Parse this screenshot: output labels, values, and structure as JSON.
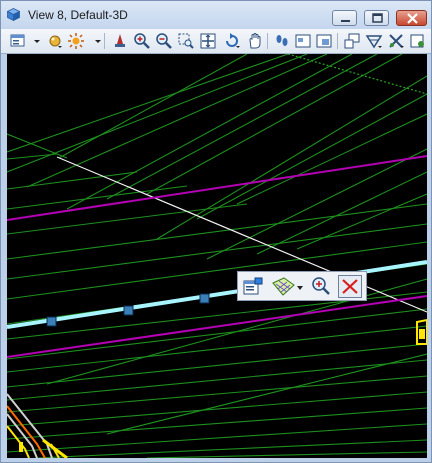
{
  "window": {
    "title": "View 8, Default-3D",
    "controls": [
      "minimize-icon",
      "maximize-icon",
      "close-icon"
    ]
  },
  "toolbar": {
    "icons": [
      "view-attributes-icon",
      "dropdown-arrow-icon",
      "display-style-icon",
      "lighting-icon",
      "update-view-icon",
      "zoom-in-icon",
      "zoom-out-icon",
      "window-area-icon",
      "fit-view-icon",
      "rotate-view-icon",
      "pan-view-icon",
      "walk-icon",
      "previous-view-icon",
      "next-view-icon",
      "copy-view-icon",
      "clip-volume-icon",
      "clip-mask-icon",
      "camera-icon",
      "view-toggles-icon"
    ]
  },
  "popup": {
    "icons": [
      "properties-icon",
      "drape-map-icon",
      "zoom-selection-icon",
      "close-popup-icon"
    ]
  },
  "colors": {
    "background": "#000000",
    "grid_lines": "#1e8f1e",
    "magenta": "#b400b4",
    "cyan_line": "#a8f4ff",
    "white_line": "#f0f0f0",
    "yellow_element": "#ffe600",
    "close_red": "#d61f1f"
  }
}
